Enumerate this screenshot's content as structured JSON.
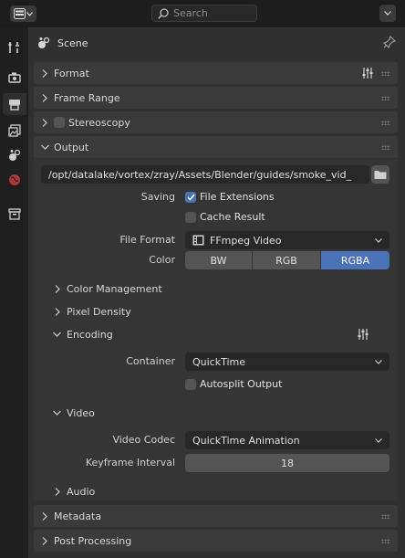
{
  "header": {
    "search_placeholder": "Search"
  },
  "scene_label": "Scene",
  "panels": {
    "format": "Format",
    "frame_range": "Frame Range",
    "stereoscopy": "Stereoscopy",
    "output": "Output",
    "metadata": "Metadata",
    "post_processing": "Post Processing"
  },
  "output": {
    "path": "/opt/datalake/vortex/zray/Assets/Blender/guides/smoke_vid_",
    "saving_label": "Saving",
    "file_extensions": {
      "label": "File Extensions",
      "checked": true
    },
    "cache_result": {
      "label": "Cache Result",
      "checked": false
    },
    "file_format_label": "File Format",
    "file_format_value": "FFmpeg Video",
    "color_label": "Color",
    "color_options": [
      "BW",
      "RGB",
      "RGBA"
    ],
    "color_selected": "RGBA",
    "color_management": "Color Management",
    "pixel_density": "Pixel Density",
    "encoding": "Encoding",
    "container_label": "Container",
    "container_value": "QuickTime",
    "autosplit": {
      "label": "Autosplit Output",
      "checked": false
    },
    "video": "Video",
    "video_codec_label": "Video Codec",
    "video_codec_value": "QuickTime Animation",
    "keyframe_label": "Keyframe Interval",
    "keyframe_value": "18",
    "audio": "Audio"
  },
  "colors": {
    "accent": "#4a72b8",
    "panel": "#3a3a3a",
    "background": "#303030"
  }
}
